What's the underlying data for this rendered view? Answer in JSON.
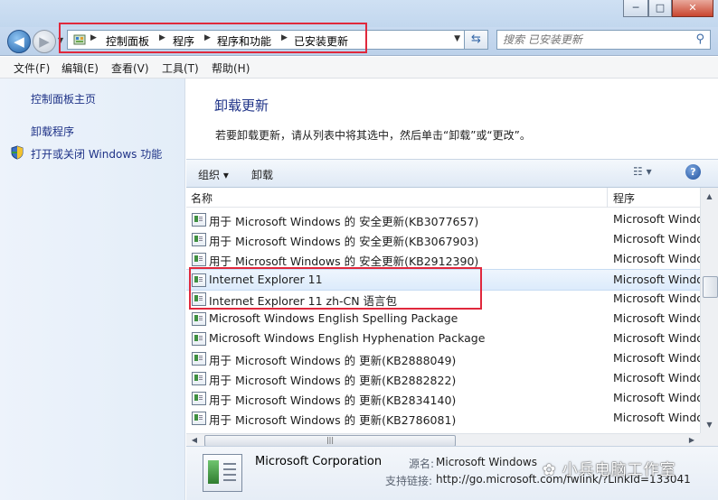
{
  "window": {
    "min_label": "─",
    "max_label": "□",
    "close_label": "✕"
  },
  "nav": {
    "back_glyph": "◀",
    "forward_glyph": "▶",
    "breadcrumbs": [
      "控制面板",
      "程序",
      "程序和功能",
      "已安装更新"
    ],
    "search_placeholder": "搜索 已安装更新"
  },
  "menu": [
    "文件(F)",
    "编辑(E)",
    "查看(V)",
    "工具(T)",
    "帮助(H)"
  ],
  "sidebar": {
    "home": "控制面板主页",
    "uninstall": "卸载程序",
    "features": "打开或关闭 Windows 功能"
  },
  "main": {
    "title": "卸载更新",
    "description": "若要卸载更新，请从列表中将其选中，然后单击“卸载”或“更改”。"
  },
  "toolbar": {
    "organize": "组织 ▾",
    "uninstall": "卸载",
    "help": "?"
  },
  "columns": {
    "name": "名称",
    "program": "程序"
  },
  "rows": [
    {
      "name": "用于 Microsoft Windows 的 安全更新(KB3077657)",
      "program": "Microsoft Windows"
    },
    {
      "name": "用于 Microsoft Windows 的 安全更新(KB3067903)",
      "program": "Microsoft Windows"
    },
    {
      "name": "用于 Microsoft Windows 的 安全更新(KB2912390)",
      "program": "Microsoft Windows"
    },
    {
      "name": "Internet Explorer 11",
      "program": "Microsoft Windows"
    },
    {
      "name": "Internet Explorer 11 zh-CN 语言包",
      "program": "Microsoft Windows"
    },
    {
      "name": "Microsoft Windows English Spelling Package",
      "program": "Microsoft Windows"
    },
    {
      "name": "Microsoft Windows English Hyphenation Package",
      "program": "Microsoft Windows"
    },
    {
      "name": "用于 Microsoft Windows 的 更新(KB2888049)",
      "program": "Microsoft Windows"
    },
    {
      "name": "用于 Microsoft Windows 的 更新(KB2882822)",
      "program": "Microsoft Windows"
    },
    {
      "name": "用于 Microsoft Windows 的 更新(KB2834140)",
      "program": "Microsoft Windows"
    },
    {
      "name": "用于 Microsoft Windows 的 更新(KB2786081)",
      "program": "Microsoft Windows"
    }
  ],
  "details": {
    "publisher": "Microsoft Corporation",
    "source_label": "源名:",
    "source_value": "Microsoft Windows",
    "support_label": "支持链接:",
    "support_value": "http://go.microsoft.com/fwlink/?LinkId=133041"
  },
  "watermark": "小兵电脑工作室",
  "colors": {
    "highlight": "#e0283c",
    "link": "#1e3287"
  }
}
